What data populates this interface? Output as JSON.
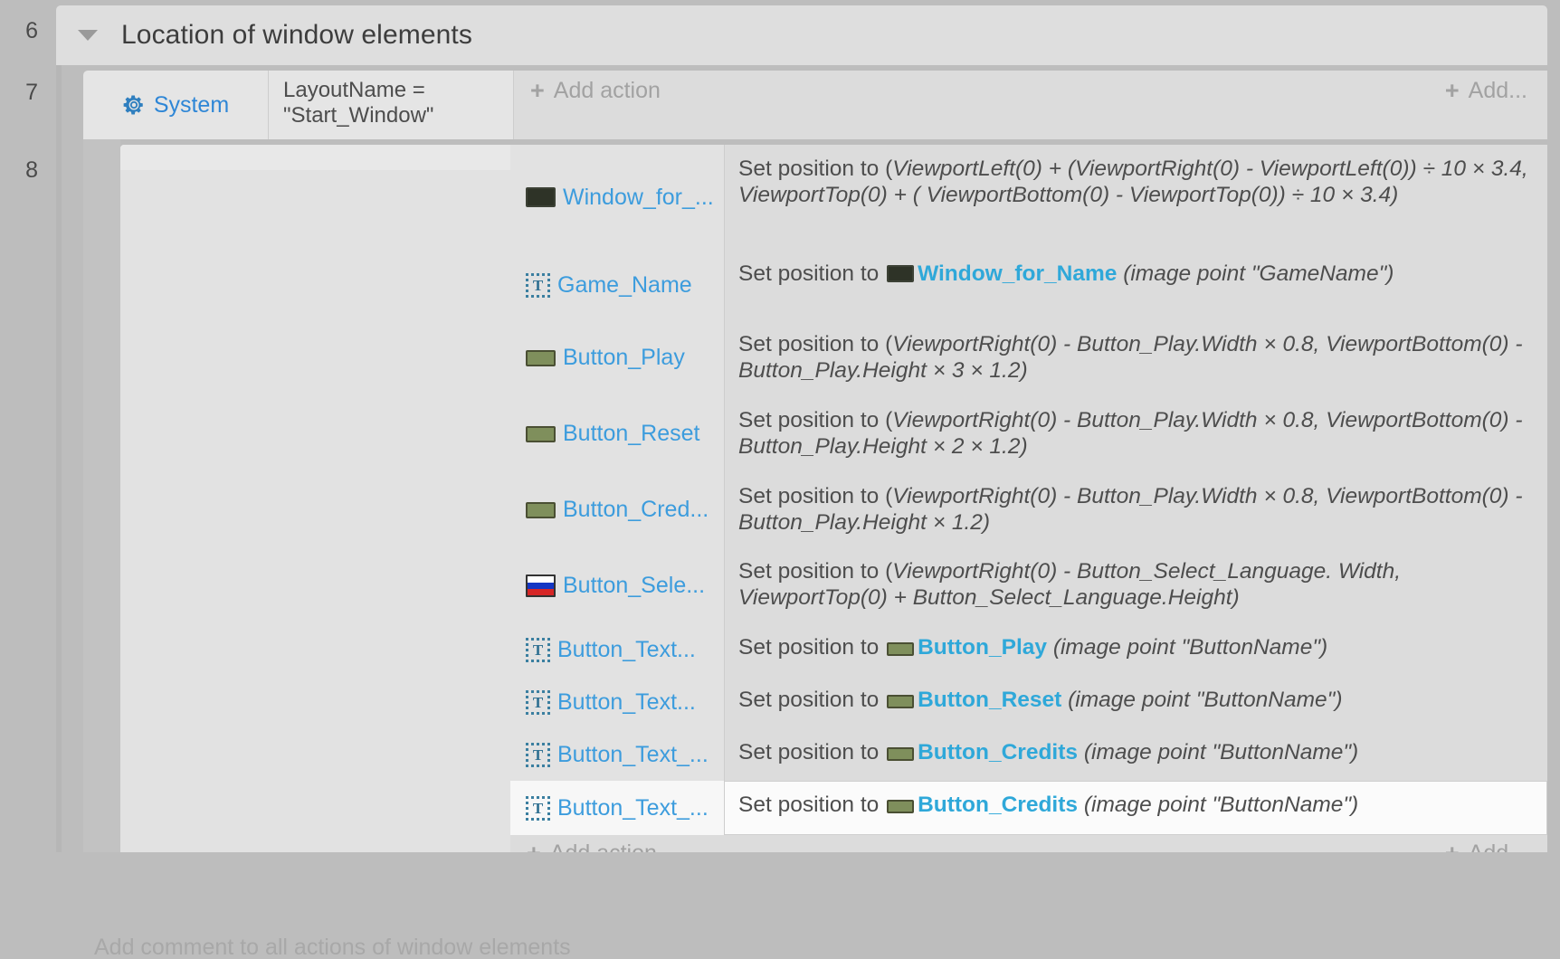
{
  "gutter": {
    "row_numbers": [
      "6",
      "7",
      "8"
    ]
  },
  "group": {
    "title": "Location of window elements",
    "collapse_icon": "triangle-down-icon"
  },
  "event": {
    "collapse_icon": "triangle-down-icon",
    "object_name": "System",
    "object_icon": "gear-icon",
    "condition_text": "LayoutName =\n\"Start_Window\"",
    "add_action_label": "Add action",
    "add_label": "Add..."
  },
  "actions": [
    {
      "object": "Window_for_...",
      "icon": "window-sprite-icon",
      "text_prefix": "Set position to (",
      "text": "Set position to (ViewportLeft(0) + (ViewportRight(0) - ViewportLeft(0)) ÷ 10 × 3.4, ViewportTop(0) + ( ViewportBottom(0) - ViewportTop(0)) ÷ 10 × 3.4)",
      "selected": false
    },
    {
      "object": "Game_Name",
      "icon": "text-object-icon",
      "text_lead": "Set position to ",
      "ref_icon": "window-sprite-icon",
      "ref_object": "Window_for_Name",
      "text_tail": " (image point \"GameName\")",
      "selected": false
    },
    {
      "object": "Button_Play",
      "icon": "button-sprite-icon",
      "text": "Set position to (ViewportRight(0) - Button_Play.Width × 0.8, ViewportBottom(0) - Button_Play.Height × 3 × 1.2)",
      "selected": false
    },
    {
      "object": "Button_Reset",
      "icon": "button-sprite-icon",
      "text": "Set position to (ViewportRight(0) - Button_Play.Width × 0.8, ViewportBottom(0) - Button_Play.Height × 2 × 1.2)",
      "selected": false
    },
    {
      "object": "Button_Cred...",
      "icon": "button-sprite-icon",
      "text": "Set position to (ViewportRight(0) - Button_Play.Width × 0.8, ViewportBottom(0) - Button_Play.Height × 1.2)",
      "selected": false
    },
    {
      "object": "Button_Sele...",
      "icon": "russian-flag-icon",
      "text": "Set position to (ViewportRight(0) - Button_Select_Language. Width, ViewportTop(0) + Button_Select_Language.Height)",
      "selected": false
    },
    {
      "object": "Button_Text...",
      "icon": "text-object-icon",
      "text_lead": "Set position to ",
      "ref_icon": "button-sprite-icon",
      "ref_object": "Button_Play",
      "text_tail": " (image point \"ButtonName\")",
      "selected": false
    },
    {
      "object": "Button_Text...",
      "icon": "text-object-icon",
      "text_lead": "Set position to ",
      "ref_icon": "button-sprite-icon",
      "ref_object": "Button_Reset",
      "text_tail": " (image point \"ButtonName\")",
      "selected": false
    },
    {
      "object": "Button_Text_...",
      "icon": "text-object-icon",
      "text_lead": "Set position to ",
      "ref_icon": "button-sprite-icon",
      "ref_object": "Button_Credits",
      "text_tail": " (image point \"ButtonName\")",
      "selected": false
    },
    {
      "object": "Button_Text_...",
      "icon": "text-object-icon",
      "text_lead": "Set position to ",
      "ref_icon": "button-sprite-icon",
      "ref_object": "Button_Credits",
      "text_tail": " (image point \"ButtonName\")",
      "selected": true
    }
  ],
  "sub_footer": {
    "add_action_label": "Add action",
    "add_label": "Add..."
  },
  "bottom_hint": "Add comment to all actions of window elements",
  "colors": {
    "object_link": "#3c9cdd",
    "system_link": "#2e86d6",
    "ref_link": "#2fa8d9",
    "body_text": "#4d4d4d",
    "muted": "#a2a2a2",
    "canvas": "#bdbdbd",
    "row": "#dcdcdc",
    "row_selected": "#fbfbfb"
  },
  "icon_glyphs": {
    "text_object": "T",
    "plus": "+"
  }
}
